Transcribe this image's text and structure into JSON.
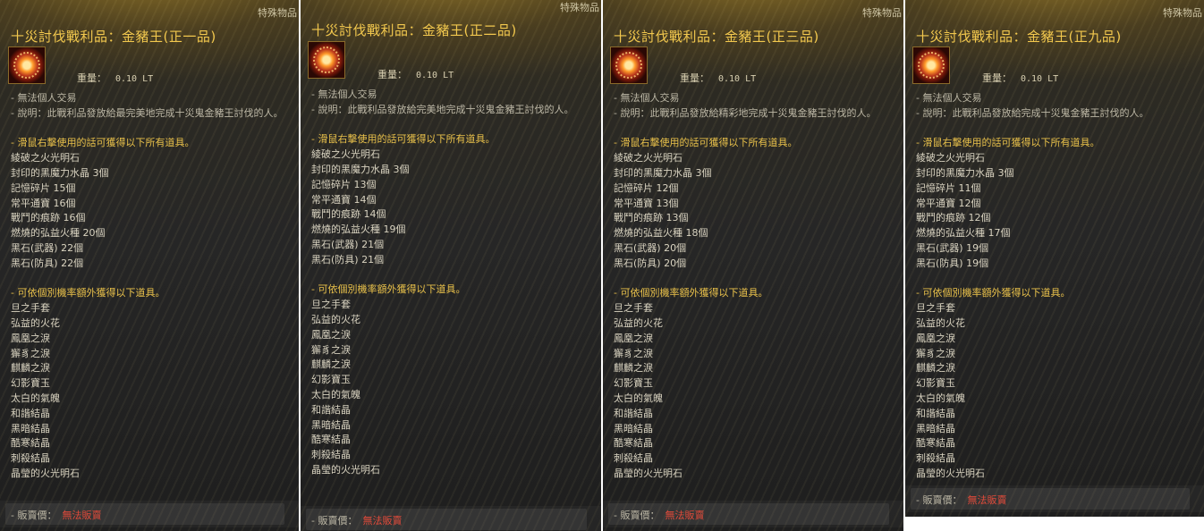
{
  "tooltips": [
    {
      "category": "特殊物品",
      "title": "十災討伐戰利品：金豬王(正一品)",
      "weight_label": "重量：",
      "weight_value": "0.10 LT",
      "trade": "- 無法個人交易",
      "desc": "- 說明：此戰利品發放給最完美地完成十災鬼金豬王討伐的人。",
      "rclick_header": "- 滑鼠右擊使用的話可獲得以下所有道具。",
      "rclick_items": [
        "綾破之火光明石",
        "封印的黑魔力水晶 3個",
        "記憶碎片 15個",
        "常平通寶 16個",
        "戰鬥的痕跡 16個",
        "燃燒的弘益火種 20個",
        "黑石(武器) 22個",
        "黑石(防具) 22個"
      ],
      "bonus_header": "- 可依個別機率額外獲得以下道具。",
      "bonus_items": [
        "旦之手套",
        "弘益的火花",
        "鳳凰之淚",
        "獬豸之淚",
        "麒麟之淚",
        "幻影寶玉",
        "太白的氣魄",
        "和諧結晶",
        "黑暗結晶",
        "酷寒結晶",
        "刺殺結晶",
        "晶瑩的火光明石"
      ],
      "price_label": "- 販賣價：",
      "price_value": "無法販賣"
    },
    {
      "category": "特殊物品",
      "title": "十災討伐戰利品：金豬王(正二品)",
      "weight_label": "重量：",
      "weight_value": "0.10 LT",
      "trade": "- 無法個人交易",
      "desc": "- 說明：此戰利品發放給完美地完成十災鬼金豬王討伐的人。",
      "rclick_header": "- 滑鼠右擊使用的話可獲得以下所有道具。",
      "rclick_items": [
        "綾破之火光明石",
        "封印的黑魔力水晶 3個",
        "記憶碎片 13個",
        "常平通寶 14個",
        "戰鬥的痕跡 14個",
        "燃燒的弘益火種 19個",
        "黑石(武器) 21個",
        "黑石(防具) 21個"
      ],
      "bonus_header": "- 可依個別機率額外獲得以下道具。",
      "bonus_items": [
        "旦之手套",
        "弘益的火花",
        "鳳凰之淚",
        "獬豸之淚",
        "麒麟之淚",
        "幻影寶玉",
        "太白的氣魄",
        "和諧結晶",
        "黑暗結晶",
        "酷寒結晶",
        "刺殺結晶",
        "晶瑩的火光明石"
      ],
      "price_label": "- 販賣價：",
      "price_value": "無法販賣"
    },
    {
      "category": "特殊物品",
      "title": "十災討伐戰利品：金豬王(正三品)",
      "weight_label": "重量：",
      "weight_value": "0.10 LT",
      "trade": "- 無法個人交易",
      "desc": "- 說明：此戰利品發放給精彩地完成十災鬼金豬王討伐的人。",
      "rclick_header": "- 滑鼠右擊使用的話可獲得以下所有道具。",
      "rclick_items": [
        "綾破之火光明石",
        "封印的黑魔力水晶 3個",
        "記憶碎片 12個",
        "常平通寶 13個",
        "戰鬥的痕跡 13個",
        "燃燒的弘益火種 18個",
        "黑石(武器) 20個",
        "黑石(防具) 20個"
      ],
      "bonus_header": "- 可依個別機率額外獲得以下道具。",
      "bonus_items": [
        "旦之手套",
        "弘益的火花",
        "鳳凰之淚",
        "獬豸之淚",
        "麒麟之淚",
        "幻影寶玉",
        "太白的氣魄",
        "和諧結晶",
        "黑暗結晶",
        "酷寒結晶",
        "刺殺結晶",
        "晶瑩的火光明石"
      ],
      "price_label": "- 販賣價：",
      "price_value": "無法販賣"
    },
    {
      "category": "特殊物品",
      "title": "十災討伐戰利品：金豬王(正九品)",
      "weight_label": "重量：",
      "weight_value": "0.10 LT",
      "trade": "- 無法個人交易",
      "desc": "- 說明：此戰利品發放給完成十災鬼金豬王討伐的人。",
      "rclick_header": "- 滑鼠右擊使用的話可獲得以下所有道具。",
      "rclick_items": [
        "綾破之火光明石",
        "封印的黑魔力水晶 3個",
        "記憶碎片 11個",
        "常平通寶 12個",
        "戰鬥的痕跡 12個",
        "燃燒的弘益火種 17個",
        "黑石(武器) 19個",
        "黑石(防具) 19個"
      ],
      "bonus_header": "- 可依個別機率額外獲得以下道具。",
      "bonus_items": [
        "旦之手套",
        "弘益的火花",
        "鳳凰之淚",
        "獬豸之淚",
        "麒麟之淚",
        "幻影寶玉",
        "太白的氣魄",
        "和諧結晶",
        "黑暗結晶",
        "酷寒結晶",
        "刺殺結晶",
        "晶瑩的火光明石"
      ],
      "price_label": "- 販賣價：",
      "price_value": "無法販賣"
    }
  ]
}
